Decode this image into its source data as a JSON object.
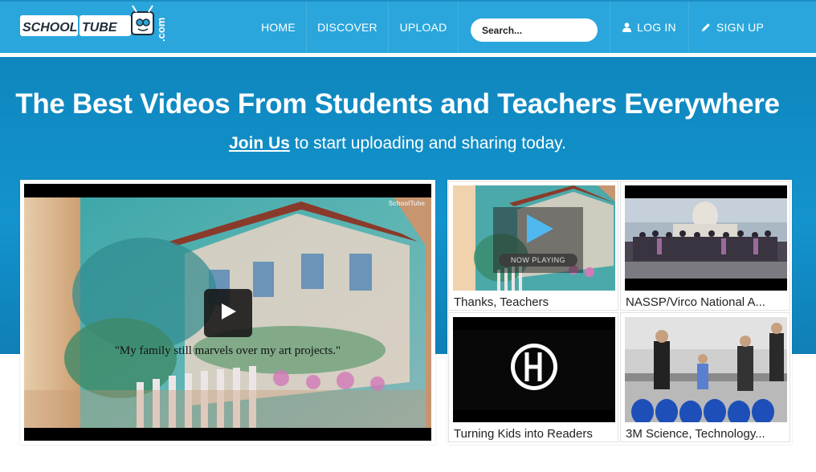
{
  "brand": {
    "logo_text": "SCHOOL TUBE",
    "logo_suffix": ".com",
    "brand_color": "#2aa6dc"
  },
  "nav": {
    "home": "HOME",
    "discover": "DISCOVER",
    "upload": "UPLOAD",
    "search_placeholder": "Search...",
    "login": "LOG IN",
    "signup": "SIGN UP",
    "login_icon": "user-icon",
    "signup_icon": "pencil-icon"
  },
  "hero": {
    "title": "The Best Videos From Students and Teachers Everywhere",
    "join_link": "Join Us",
    "subtitle_rest": " to start uploading and sharing today."
  },
  "player": {
    "caption": "\"My family still marvels over my art projects.\"",
    "watermark": "SchoolTube",
    "play_icon": "play-icon"
  },
  "videos": [
    {
      "title": "Thanks, Teachers",
      "status": "NOW PLAYING"
    },
    {
      "title": "NASSP/Virco National A..."
    },
    {
      "title": "Turning Kids into Readers"
    },
    {
      "title": "3M Science, Technology..."
    }
  ]
}
